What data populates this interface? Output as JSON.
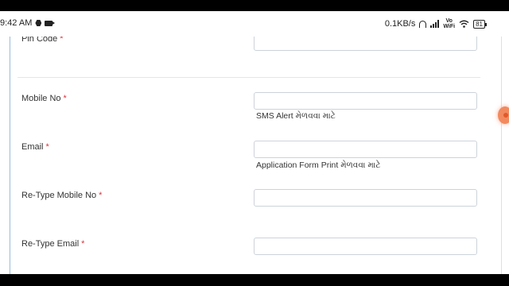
{
  "status_bar": {
    "time": "9:42 AM",
    "network_speed": "0.1KB/s",
    "volte_label_top": "Vo",
    "volte_label_bottom": "WiFi",
    "battery_level": "81"
  },
  "form": {
    "fields": [
      {
        "label": "Pin Code",
        "required": "*",
        "value": "",
        "hint": ""
      },
      {
        "label": "Mobile No",
        "required": "*",
        "value": "",
        "hint": "SMS Alert મેળવવા માટે"
      },
      {
        "label": "Email",
        "required": "*",
        "value": "",
        "hint": "Application Form Print મેળવવા માટે"
      },
      {
        "label": "Re-Type Mobile No",
        "required": "*",
        "value": "",
        "hint": ""
      },
      {
        "label": "Re-Type Email",
        "required": "*",
        "value": "",
        "hint": ""
      }
    ]
  },
  "icons": {
    "status_left": [
      "hexagon-icon",
      "video-camera-icon"
    ],
    "status_right": [
      "headphone-icon",
      "signal-icon",
      "wifi-icon",
      "battery-icon"
    ],
    "scroll": "scroll-handle-icon"
  },
  "colors": {
    "required_asterisk": "#d9363e",
    "input_border": "#ccd3db",
    "frame_line": "#9bbbd9",
    "scroll_handle": "#f28a5f"
  }
}
